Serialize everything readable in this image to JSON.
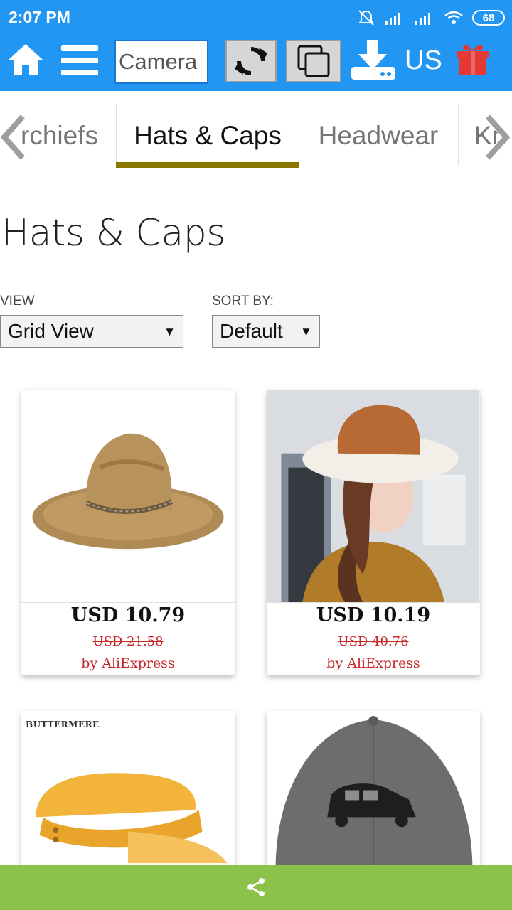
{
  "status_bar": {
    "time": "2:07 PM",
    "battery": "68"
  },
  "toolbar": {
    "search_value": "Camera",
    "region": "US"
  },
  "category_tabs": [
    {
      "label": "rchiefs"
    },
    {
      "label": "Hats & Caps",
      "active": true
    },
    {
      "label": "Headwear"
    },
    {
      "label": "Kn"
    }
  ],
  "page_title": "Hats & Caps",
  "controls": {
    "view_label": "VIEW",
    "view_value": "Grid View",
    "sort_label": "SORT BY:",
    "sort_value": "Default"
  },
  "products": [
    {
      "price": "USD 10.79",
      "old_price": "USD 21.58",
      "seller": "by AliExpress"
    },
    {
      "price": "USD 10.19",
      "old_price": "USD 40.76",
      "seller": "by AliExpress"
    },
    {
      "brand": "BUTTERMERE"
    },
    {}
  ],
  "colors": {
    "header": "#2196f3",
    "tab_active_underline": "#8a7700",
    "price_old": "#c62828",
    "share_bar": "#8bc34a",
    "gift": "#e53935"
  }
}
